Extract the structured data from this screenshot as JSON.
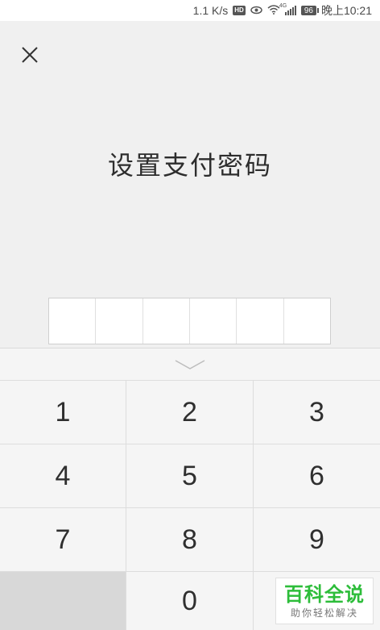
{
  "status_bar": {
    "speed": "1.1 K/s",
    "hd_badge": "HD",
    "network_type": "4G",
    "battery": "96",
    "time": "晚上10:21",
    "icons": [
      "eye-icon",
      "wifi-icon",
      "signal-icon",
      "battery-icon"
    ]
  },
  "page": {
    "close_icon": "close-icon",
    "title": "设置支付密码",
    "password_length": 6,
    "entered_digits": 0
  },
  "keyboard": {
    "collapse_icon": "chevron-down-icon",
    "keys": [
      "1",
      "2",
      "3",
      "4",
      "5",
      "6",
      "7",
      "8",
      "9",
      "",
      "0",
      ""
    ]
  },
  "watermark": {
    "main": "百科全说",
    "sub": "助你轻松解决"
  },
  "colors": {
    "background": "#f0f0f0",
    "keyboard": "#f5f5f5",
    "watermark_green": "#2dbd3a"
  }
}
